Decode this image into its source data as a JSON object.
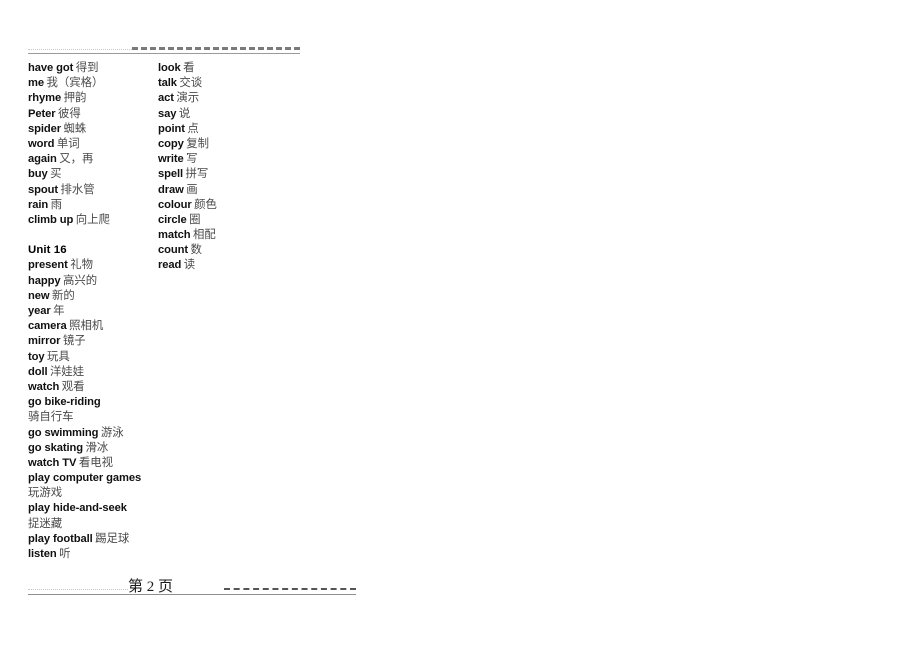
{
  "document": {
    "header_rule": "dashed-divider",
    "footer": {
      "page_label": "第 2 页",
      "rule": "dashed-divider"
    }
  },
  "columns": {
    "left": {
      "entries": [
        {
          "en": "have got",
          "zh": "得到"
        },
        {
          "en": "me",
          "zh": "我（宾格）"
        },
        {
          "en": "rhyme",
          "zh": "押韵"
        },
        {
          "en": "Peter",
          "zh": "彼得"
        },
        {
          "en": "spider",
          "zh": "蜘蛛"
        },
        {
          "en": "word",
          "zh": "单词"
        },
        {
          "en": "again",
          "zh": "又，再"
        },
        {
          "en": "buy",
          "zh": "买"
        },
        {
          "en": "spout",
          "zh": "排水管"
        },
        {
          "en": "rain",
          "zh": "雨"
        },
        {
          "en": "climb up",
          "zh": "向上爬"
        }
      ],
      "unit_heading": "Unit 16",
      "entries2": [
        {
          "en": "present",
          "zh": "礼物"
        },
        {
          "en": "happy",
          "zh": "高兴的"
        },
        {
          "en": "new",
          "zh": "新的"
        },
        {
          "en": "year",
          "zh": "年"
        },
        {
          "en": "camera",
          "zh": "照相机"
        },
        {
          "en": "mirror",
          "zh": "镜子"
        },
        {
          "en": "toy",
          "zh": "玩具"
        },
        {
          "en": "doll",
          "zh": "洋娃娃"
        },
        {
          "en": "watch",
          "zh": "观看"
        },
        {
          "en": "go bike-riding",
          "zh": ""
        },
        {
          "en": "",
          "zh": "骑自行车"
        },
        {
          "en": "go swimming",
          "zh": "游泳"
        },
        {
          "en": "go skating",
          "zh": "滑冰"
        },
        {
          "en": "watch TV",
          "zh": "看电视"
        },
        {
          "en": "play computer games",
          "zh": ""
        },
        {
          "en": "",
          "zh": "玩游戏"
        },
        {
          "en": "play hide-and-seek",
          "zh": ""
        },
        {
          "en": "",
          "zh": "捉迷藏"
        },
        {
          "en": "play football",
          "zh": "踢足球"
        },
        {
          "en": "listen",
          "zh": "听"
        }
      ]
    },
    "right": {
      "entries": [
        {
          "en": "look",
          "zh": "看"
        },
        {
          "en": "talk",
          "zh": "交谈"
        },
        {
          "en": "act",
          "zh": "演示"
        },
        {
          "en": "say",
          "zh": "说"
        },
        {
          "en": "point",
          "zh": "点"
        },
        {
          "en": "copy",
          "zh": "复制"
        },
        {
          "en": "write",
          "zh": "写"
        },
        {
          "en": "spell",
          "zh": "拼写"
        },
        {
          "en": "draw",
          "zh": "画"
        },
        {
          "en": "colour",
          "zh": "颜色"
        },
        {
          "en": "circle",
          "zh": "圈"
        },
        {
          "en": "match",
          "zh": "相配"
        },
        {
          "en": "count",
          "zh": "数"
        },
        {
          "en": "read",
          "zh": "读"
        }
      ]
    }
  }
}
